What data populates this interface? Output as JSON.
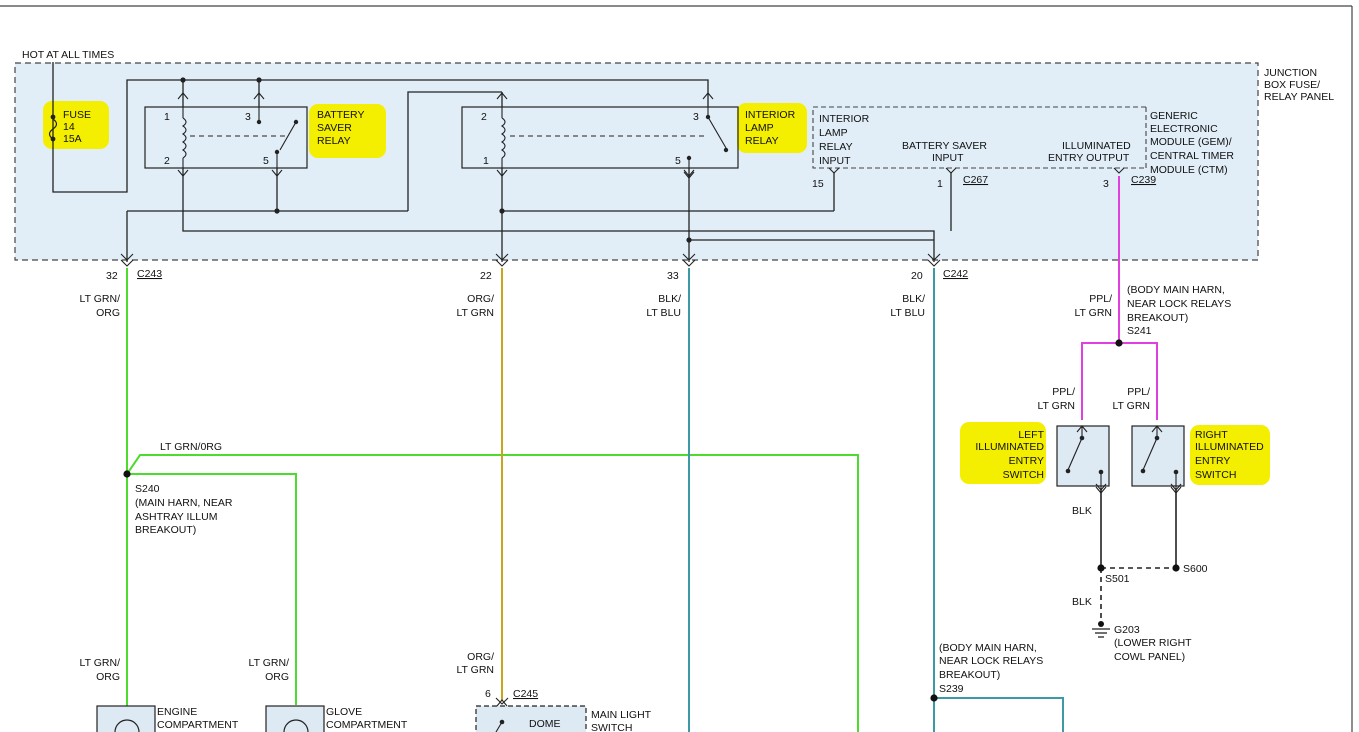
{
  "colors": {
    "junction_fill": "#e1eef7",
    "highlight": "#f4ef00",
    "wire_lt_grn_org": "#4ddb2e",
    "wire_org_lt_grn": "#c9a51c",
    "wire_blk_lt_blu": "#3c9aa5",
    "wire_ppl_lt_grn": "#e040e0",
    "wire_black": "#222222"
  },
  "junction_box": {
    "hot_label": "HOT AT ALL TIMES",
    "title_lines": [
      "JUNCTION",
      "BOX FUSE/",
      "RELAY PANEL"
    ],
    "fuse": {
      "lines": [
        "FUSE",
        "14",
        "15A"
      ]
    }
  },
  "battery_saver_relay": {
    "name_lines": [
      "BATTERY",
      "SAVER",
      "RELAY"
    ],
    "pins": [
      "1",
      "2",
      "3",
      "5"
    ]
  },
  "interior_lamp_relay": {
    "name_lines": [
      "INTERIOR",
      "LAMP",
      "RELAY"
    ],
    "pins": [
      "2",
      "1",
      "3",
      "5"
    ]
  },
  "gem": {
    "title_lines": [
      "GENERIC",
      "ELECTRONIC",
      "MODULE (GEM)/",
      "CENTRAL TIMER",
      "MODULE (CTM)"
    ],
    "interior_lamp_input_lines": [
      "INTERIOR",
      "LAMP",
      "RELAY",
      "INPUT"
    ],
    "battery_saver_input_lines": [
      "BATTERY SAVER",
      "INPUT"
    ],
    "illuminated_entry_output_lines": [
      "ILLUMINATED",
      "ENTRY OUTPUT"
    ],
    "pin_15": "15",
    "pin_1": "1",
    "pin_3": "3",
    "conn_c267": "C267",
    "conn_c239": "C239"
  },
  "connectors": {
    "pin_32": "32",
    "c243": "C243",
    "pin_22": "22",
    "pin_33": "33",
    "pin_20": "20",
    "c242": "C242",
    "pin_6": "6",
    "c245": "C245"
  },
  "wire_labels": {
    "lt_grn_org_32": [
      "LT GRN/",
      "ORG"
    ],
    "org_lt_grn_22": [
      "ORG/",
      "LT GRN"
    ],
    "blk_lt_blu_33": [
      "BLK/",
      "LT BLU"
    ],
    "blk_lt_blu_20": [
      "BLK/",
      "LT BLU"
    ],
    "ppl_lt_grn_main": [
      "PPL/",
      "LT GRN"
    ],
    "ppl_lt_grn_left": [
      "PPL/",
      "LT GRN"
    ],
    "ppl_lt_grn_right": [
      "PPL/",
      "LT GRN"
    ],
    "lt_grn_org_horizontal": "LT GRN/0RG",
    "lt_grn_org_engine": [
      "LT GRN/",
      "ORG"
    ],
    "lt_grn_org_glove": [
      "LT GRN/",
      "ORG"
    ],
    "org_lt_grn_dome": [
      "ORG/",
      "LT GRN"
    ],
    "blk_switch": "BLK",
    "blk_ground": "BLK"
  },
  "splices": {
    "s241": [
      "(BODY MAIN HARN,",
      "NEAR LOCK RELAYS",
      "BREAKOUT)",
      "S241"
    ],
    "s240": [
      "S240",
      "(MAIN HARN, NEAR",
      "ASHTRAY ILLUM",
      "BREAKOUT)"
    ],
    "s239": [
      "(BODY MAIN HARN,",
      "NEAR LOCK RELAYS",
      "BREAKOUT)",
      "S239"
    ],
    "s501": "S501",
    "s600": "S600"
  },
  "switches": {
    "left_lines": [
      "LEFT",
      "ILLUMINATED",
      "ENTRY",
      "SWITCH"
    ],
    "right_lines": [
      "RIGHT",
      "ILLUMINATED",
      "ENTRY",
      "SWITCH"
    ]
  },
  "ground": {
    "lines": [
      "G203",
      "(LOWER RIGHT",
      "COWL PANEL)"
    ]
  },
  "bottom_components": {
    "engine_lines": [
      "ENGINE",
      "COMPARTMENT"
    ],
    "glove_lines": [
      "GLOVE",
      "COMPARTMENT"
    ],
    "dome_label": "DOME",
    "main_light_switch_lines": [
      "MAIN LIGHT",
      "SWITCH"
    ]
  }
}
